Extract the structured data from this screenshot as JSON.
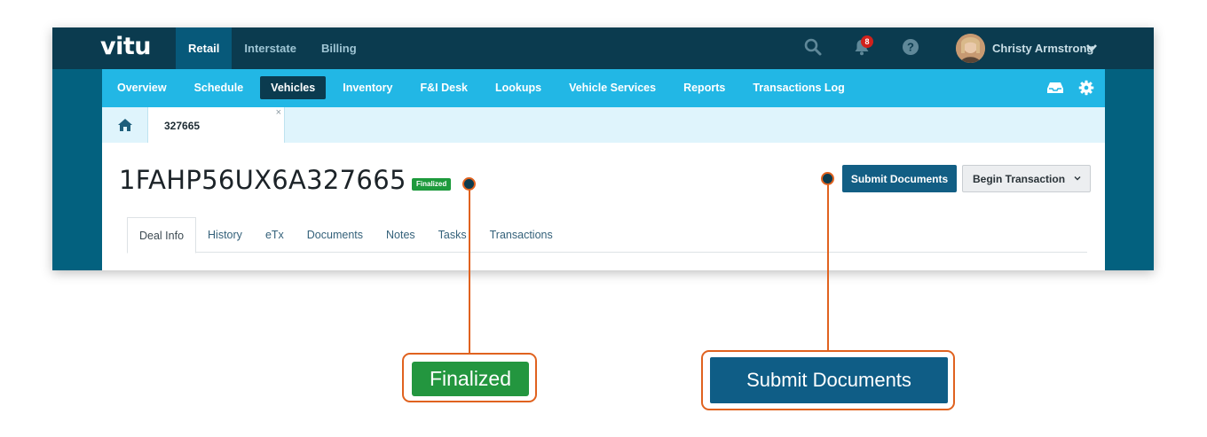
{
  "app": {
    "logo": "vitu"
  },
  "topnav": {
    "items": [
      {
        "label": "Retail",
        "active": true
      },
      {
        "label": "Interstate",
        "active": false
      },
      {
        "label": "Billing",
        "active": false
      }
    ],
    "notification_count": "8",
    "user_name": "Christy Armstrong",
    "icons": [
      "search-icon",
      "bell-icon",
      "help-icon",
      "chevron-down-icon"
    ]
  },
  "subnav": {
    "items": [
      {
        "label": "Overview",
        "active": false
      },
      {
        "label": "Schedule",
        "active": false
      },
      {
        "label": "Vehicles",
        "active": true
      },
      {
        "label": "Inventory",
        "active": false
      },
      {
        "label": "F&I Desk",
        "active": false
      },
      {
        "label": "Lookups",
        "active": false
      },
      {
        "label": "Vehicle Services",
        "active": false
      },
      {
        "label": "Reports",
        "active": false
      },
      {
        "label": "Transactions Log",
        "active": false
      }
    ],
    "icons": [
      "inbox-icon",
      "gear-icon"
    ]
  },
  "doc_tab": {
    "label": "327665",
    "close": "×"
  },
  "page": {
    "vin": "1FAHP56UX6A327665",
    "status_badge": "Finalized",
    "submit_button": "Submit Documents",
    "begin_button": "Begin Transaction"
  },
  "tabs": [
    {
      "label": "Deal Info",
      "active": true
    },
    {
      "label": "History",
      "active": false
    },
    {
      "label": "eTx",
      "active": false
    },
    {
      "label": "Documents",
      "active": false
    },
    {
      "label": "Notes",
      "active": false
    },
    {
      "label": "Tasks",
      "active": false
    },
    {
      "label": "Transactions",
      "active": false
    }
  ],
  "callouts": {
    "finalized": "Finalized",
    "submit": "Submit Documents"
  },
  "colors": {
    "topbar": "#0b3b4f",
    "subnav": "#22b7e5",
    "frame_bg": "#03617f",
    "status_green": "#1d9a3c",
    "primary_button": "#125e84",
    "callout_orange": "#e0621f"
  }
}
